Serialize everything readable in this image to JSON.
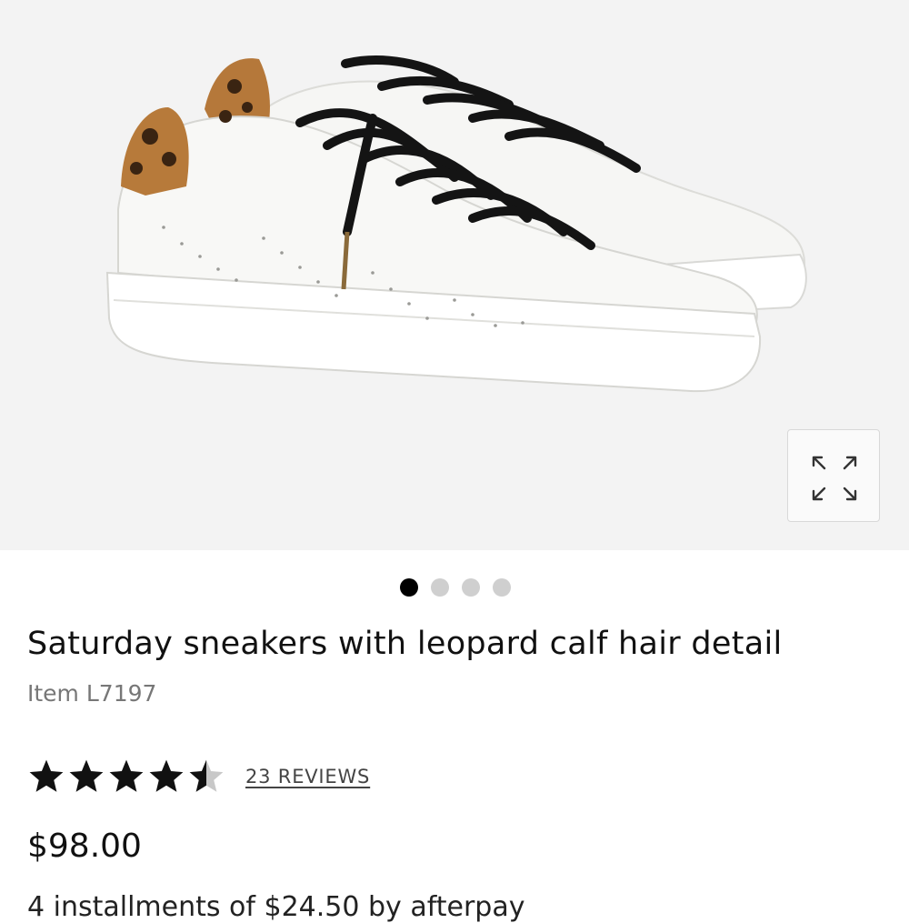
{
  "product": {
    "title": "Saturday sneakers with leopard calf hair detail",
    "item_number": "Item L7197",
    "price": "$98.00",
    "rating": 4.5,
    "rating_max": 5,
    "reviews_label": "23 REVIEWS"
  },
  "gallery": {
    "image_count": 4,
    "active_index": 0,
    "image_subject": "white leather sneakers with leopard calf hair heel tabs and black laces"
  },
  "installments": {
    "text": "4 installments of $24.50 by afterpay"
  },
  "icons": {
    "expand": "expand-arrows-icon",
    "star": "star-icon"
  },
  "colors": {
    "hero_background": "#f3f3f3",
    "active_dot": "#000000",
    "inactive_dot": "#cfcfcf",
    "star_fill": "#111111",
    "star_empty": "#c8c8c8",
    "muted_text": "#777777"
  }
}
